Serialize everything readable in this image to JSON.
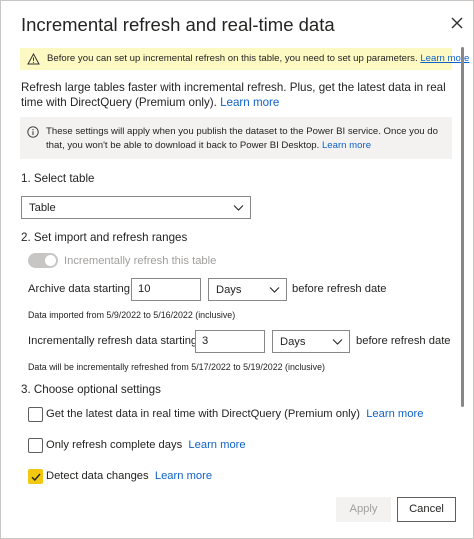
{
  "dialog": {
    "title": "Incremental refresh and real-time data",
    "close_icon": "close-icon"
  },
  "banner": {
    "icon": "warning-icon",
    "text": "Before you can set up incremental refresh on this table, you need to set up parameters.",
    "link": "Learn more"
  },
  "intro": {
    "text": "Refresh large tables faster with incremental refresh. Plus, get the latest data in real time with DirectQuery (Premium only).",
    "link": "Learn more"
  },
  "info": {
    "icon": "info-icon",
    "text": "These settings will apply when you publish the dataset to the Power BI service. Once you do that, you won't be able to download it back to Power BI Desktop.",
    "link": "Learn more"
  },
  "section1": {
    "heading": "1. Select table",
    "table_select_value": "Table"
  },
  "section2": {
    "heading": "2. Set import and refresh ranges",
    "toggle_label": "Incrementally refresh this table",
    "archive": {
      "label": "Archive data starting",
      "value": "10",
      "unit": "Days",
      "suffix": "before refresh date",
      "note": "Data imported from 5/9/2022 to 5/16/2022 (inclusive)"
    },
    "incremental": {
      "label": "Incrementally refresh data starting",
      "value": "3",
      "unit": "Days",
      "suffix": "before refresh date",
      "note": "Data will be incrementally refreshed from 5/17/2022 to 5/19/2022 (inclusive)"
    }
  },
  "section3": {
    "heading": "3. Choose optional settings",
    "options": [
      {
        "label": "Get the latest data in real time with DirectQuery (Premium only)",
        "link": "Learn more",
        "checked": false
      },
      {
        "label": "Only refresh complete days",
        "link": "Learn more",
        "checked": false
      },
      {
        "label": "Detect data changes",
        "link": "Learn more",
        "checked": true
      }
    ]
  },
  "footer": {
    "apply_label": "Apply",
    "cancel_label": "Cancel"
  },
  "colors": {
    "accent_link": "#0f62c7",
    "banner_bg": "#fcf9c3",
    "checkbox_checked": "#f2c811"
  }
}
